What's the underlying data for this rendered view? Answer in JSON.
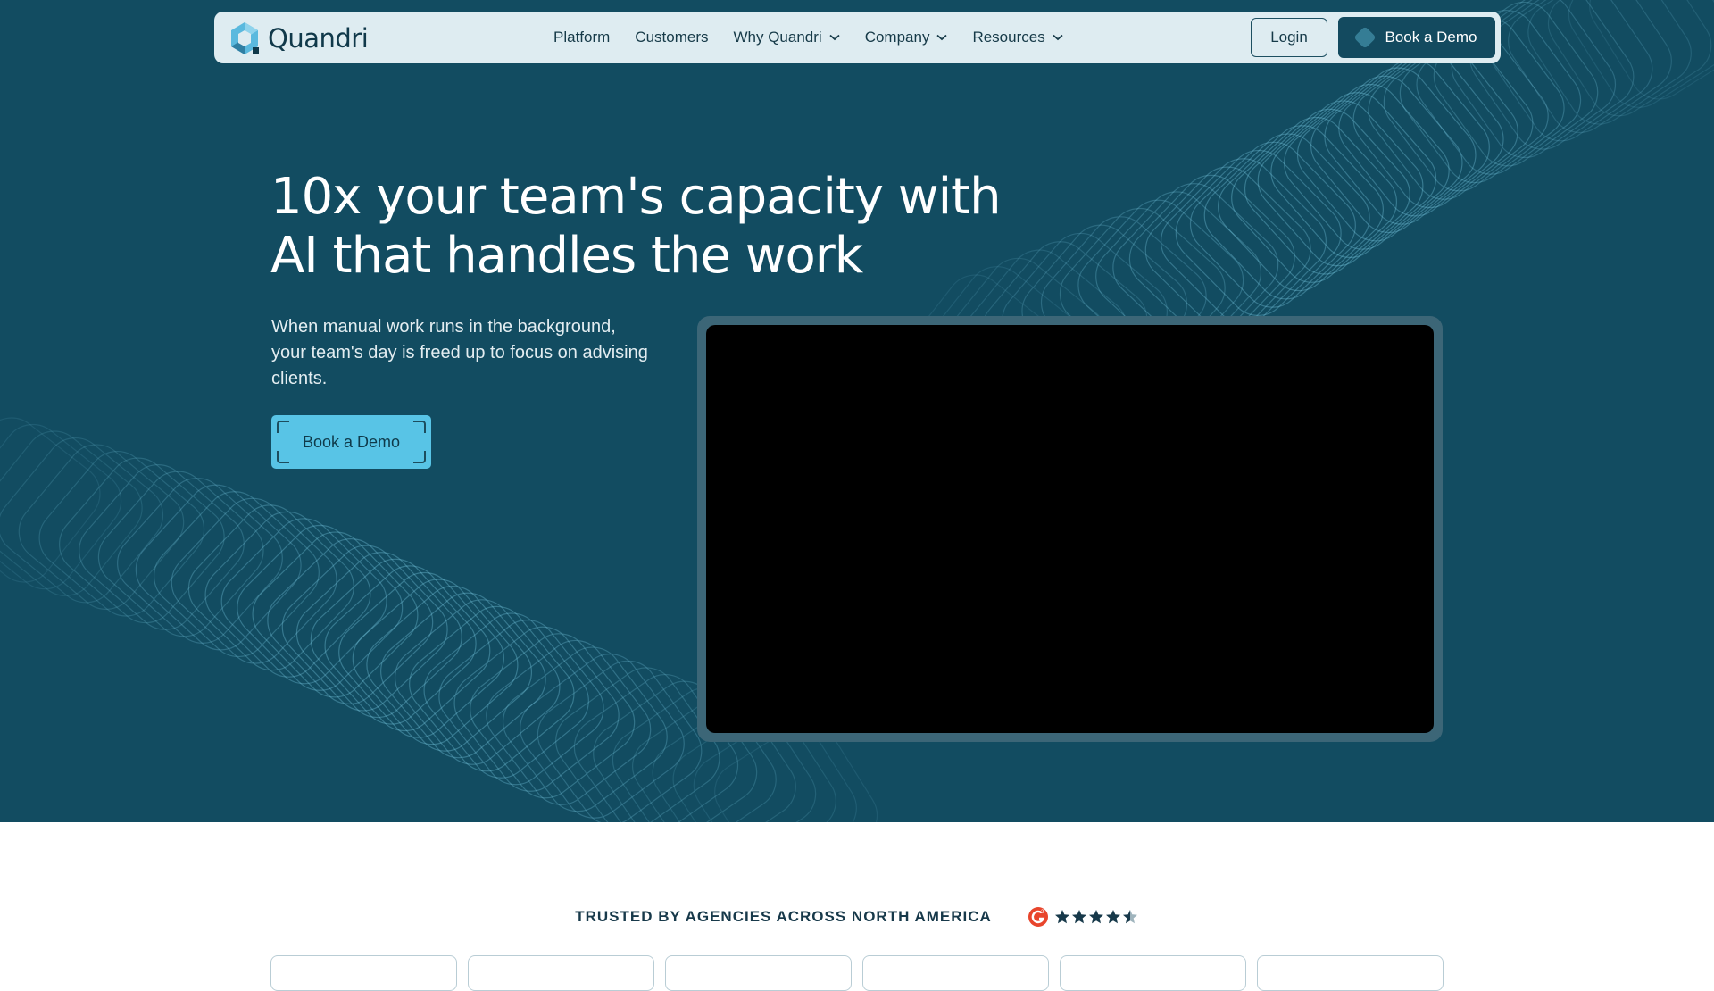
{
  "nav": {
    "brand": "Quandri",
    "items": [
      {
        "label": "Platform",
        "dropdown": false
      },
      {
        "label": "Customers",
        "dropdown": false
      },
      {
        "label": "Why Quandri",
        "dropdown": true
      },
      {
        "label": "Company",
        "dropdown": true
      },
      {
        "label": "Resources",
        "dropdown": true
      }
    ],
    "login_label": "Login",
    "demo_label": "Book a Demo"
  },
  "hero": {
    "headline_line1": "10x your team's capacity with",
    "headline_line2": "AI that handles the work",
    "subtext": "When manual work runs in the background, your team's day is freed up to focus on advising clients.",
    "cta_label": "Book a Demo"
  },
  "trusted": {
    "label": "TRUSTED BY AGENCIES ACROSS NORTH AMERICA",
    "rating_stars": 4.5,
    "rating_max": 5
  },
  "colors": {
    "hero_bg": "#124c61",
    "nav_bg": "#deecf1",
    "accent": "#58c4e6",
    "g2_red": "#e8452c"
  },
  "icons": {
    "brand_logo": "quandri-logo-icon",
    "g2": "g2-logo-icon",
    "star": "star-icon",
    "chevron": "chevron-down-icon"
  }
}
